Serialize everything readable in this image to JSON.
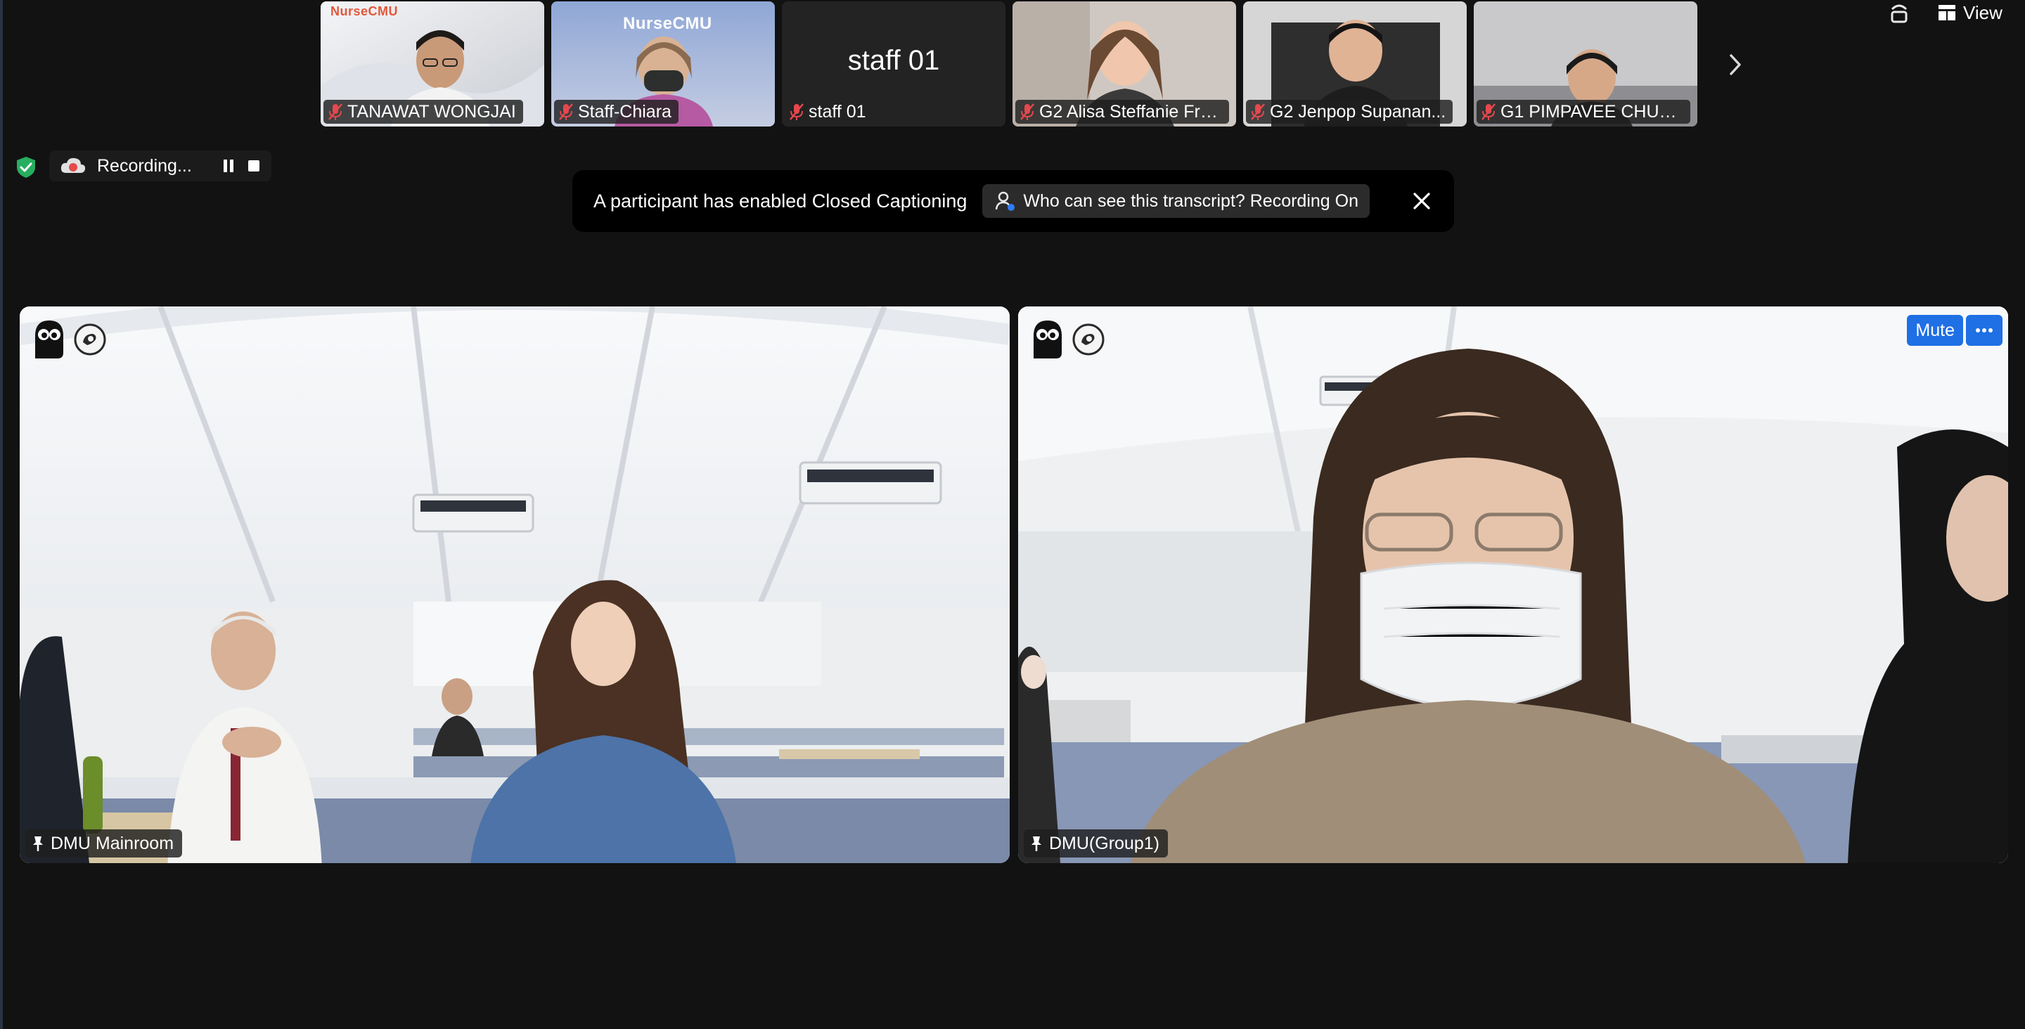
{
  "participants_strip": [
    {
      "name": "TANAWAT WONGJAI",
      "muted": true,
      "logo_text": "NurseCMU"
    },
    {
      "name": "Staff-Chiara",
      "muted": true,
      "logo_text": "NurseCMU"
    },
    {
      "name": "staff 01",
      "muted": true,
      "display_text": "staff 01"
    },
    {
      "name": "G2 Alisa Steffanie Fre...",
      "muted": true
    },
    {
      "name": "G2 Jenpop Supanan...",
      "muted": true
    },
    {
      "name": "G1 PIMPAVEE CHUAP...",
      "muted": true
    }
  ],
  "strip_next_icon": "chevron-right-icon",
  "top_right": {
    "view_label": "View",
    "icons": [
      "share-screen-icon",
      "grid-view-icon"
    ]
  },
  "recording": {
    "label": "Recording...",
    "icons": [
      "shield-check-icon",
      "cloud-record-icon",
      "pause-icon",
      "stop-icon"
    ]
  },
  "caption_banner": {
    "message": "A participant has enabled Closed Captioning",
    "chip_text": "Who can see this transcript? Recording On",
    "icons": [
      "people-icon",
      "close-icon"
    ]
  },
  "main_tiles": [
    {
      "name": "DMU Mainroom",
      "pinned": true,
      "active": false
    },
    {
      "name": "DMU(Group1)",
      "pinned": true,
      "active": true,
      "mute_label": "Mute"
    }
  ],
  "colors": {
    "background": "#121212",
    "active_speaker": "#3ec34d",
    "muted_red": "#e5484d",
    "button_blue": "#1f6fe5",
    "recording_red": "#e5484d"
  }
}
